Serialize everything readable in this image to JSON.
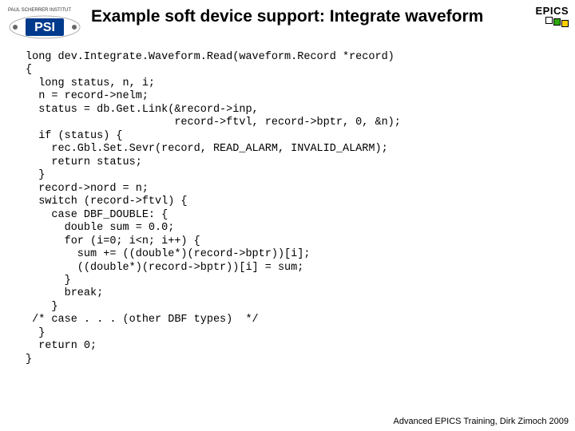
{
  "header": {
    "logo_top_text": "PAUL SCHERRER INSTITUT",
    "logo_block_text": "PSI",
    "title": "Example soft device support: Integrate waveform",
    "epics_label": "EPICS"
  },
  "code": "long dev.Integrate.Waveform.Read(waveform.Record *record)\n{\n  long status, n, i;\n  n = record->nelm;\n  status = db.Get.Link(&record->inp,\n                       record->ftvl, record->bptr, 0, &n);\n  if (status) {\n    rec.Gbl.Set.Sevr(record, READ_ALARM, INVALID_ALARM);\n    return status;\n  }\n  record->nord = n;\n  switch (record->ftvl) {\n    case DBF_DOUBLE: {\n      double sum = 0.0;\n      for (i=0; i<n; i++) {\n        sum += ((double*)(record->bptr))[i];\n        ((double*)(record->bptr))[i] = sum;\n      }\n      break;\n    }\n /* case . . . (other DBF types)  */\n  }\n  return 0;\n}",
  "footer": "Advanced EPICS Training, Dirk Zimoch 2009"
}
